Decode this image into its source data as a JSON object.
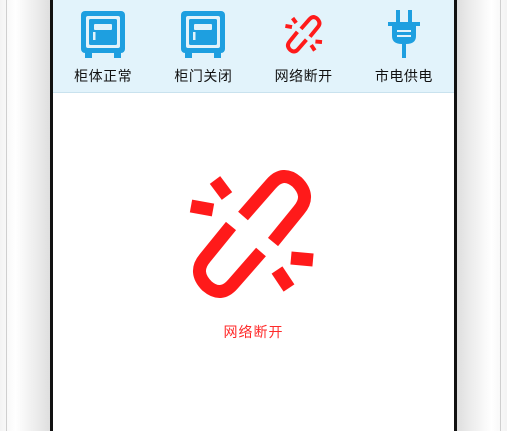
{
  "status_bar": {
    "items": [
      {
        "label": "柜体正常",
        "icon": "cabinet-normal-icon"
      },
      {
        "label": "柜门关闭",
        "icon": "cabinet-door-closed-icon"
      },
      {
        "label": "网络断开",
        "icon": "network-disconnected-icon"
      },
      {
        "label": "市电供电",
        "icon": "power-plug-icon"
      }
    ]
  },
  "main": {
    "status_text": "网络断开",
    "icon": "broken-link-icon"
  },
  "colors": {
    "accent_blue": "#1e9fe0",
    "alert_red": "#ff1a1a",
    "status_bar_bg": "#e2f3fb"
  }
}
